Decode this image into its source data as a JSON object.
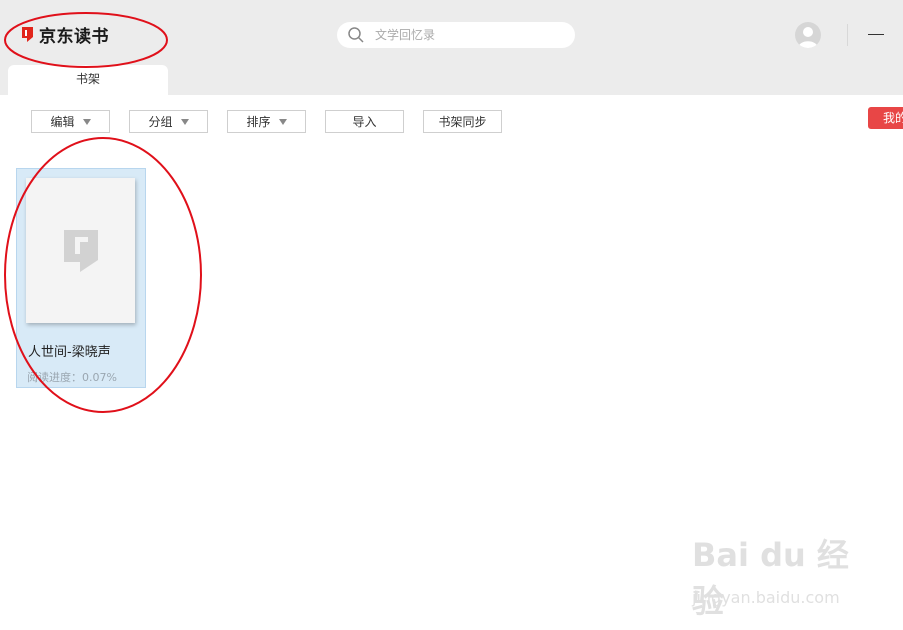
{
  "app": {
    "logo_text": "京东读书"
  },
  "search": {
    "placeholder": "文学回忆录"
  },
  "tabs": [
    {
      "label": "书架"
    }
  ],
  "toolbar": {
    "edit_label": "编辑",
    "group_label": "分组",
    "sort_label": "排序",
    "import_label": "导入",
    "sync_label": "书架同步"
  },
  "my_button_label": "我的",
  "books": [
    {
      "title": "人世间-梁晓声",
      "progress": "阅读进度：0.07%"
    }
  ],
  "watermark": {
    "brand": "Bai du 经验",
    "url": "jingyan.baidu.com"
  },
  "colors": {
    "accent": "#e84646",
    "annotation": "#e0101a",
    "selection": "#d8eaf7"
  }
}
